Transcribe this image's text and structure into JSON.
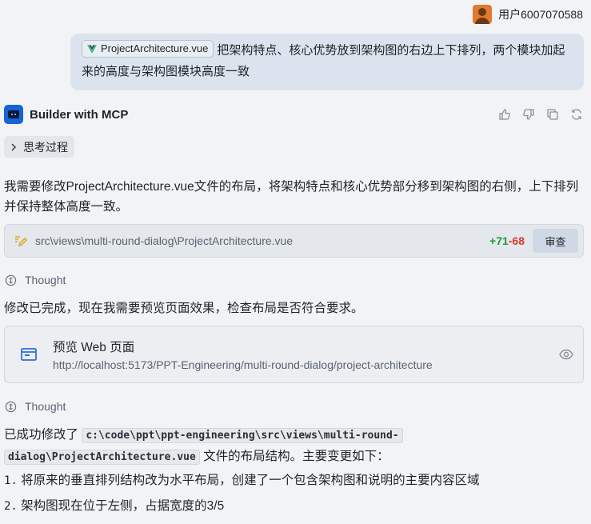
{
  "user": {
    "name": "用户6007070588"
  },
  "user_message": {
    "file_chip": "ProjectArchitecture.vue",
    "text": "把架构特点、核心优势放到架构图的右边上下排列，两个模块加起来的高度与架构图模块高度一致"
  },
  "assistant": {
    "name": "Builder with MCP",
    "thinking_label": "思考过程",
    "intro": "我需要修改ProjectArchitecture.vue文件的布局，将架构特点和核心优势部分移到架构图的右侧，上下排列并保持整体高度一致。",
    "file_change": {
      "path": "src\\views\\multi-round-dialog\\ProjectArchitecture.vue",
      "added": "+71",
      "removed": "-68",
      "review_label": "审查"
    },
    "thought_label_1": "Thought",
    "after_edit": "修改已完成，现在我需要预览页面效果，检查布局是否符合要求。",
    "preview": {
      "title": "预览 Web 页面",
      "url": "http://localhost:5173/PPT-Engineering/multi-round-dialog/project-architecture"
    },
    "thought_label_2": "Thought",
    "summary_prefix": "已成功修改了",
    "summary_code_1": "c:\\code\\ppt\\ppt-engineering\\src\\views\\multi-round-",
    "summary_code_2": "dialog\\ProjectArchitecture.vue",
    "summary_suffix": "文件的布局结构。主要变更如下：",
    "list": [
      {
        "num": "1.",
        "text": "将原来的垂直排列结构改为水平布局，创建了一个包含架构图和说明的主要内容区域"
      },
      {
        "num": "2.",
        "text": "架构图现在位于左侧，占据宽度的3/5"
      }
    ]
  },
  "colors": {
    "background": "#f2f3f5",
    "user_bubble": "#dbe4ee",
    "added": "#1c9a3f",
    "removed": "#d9362b",
    "bot_logo": "#1463d9"
  }
}
